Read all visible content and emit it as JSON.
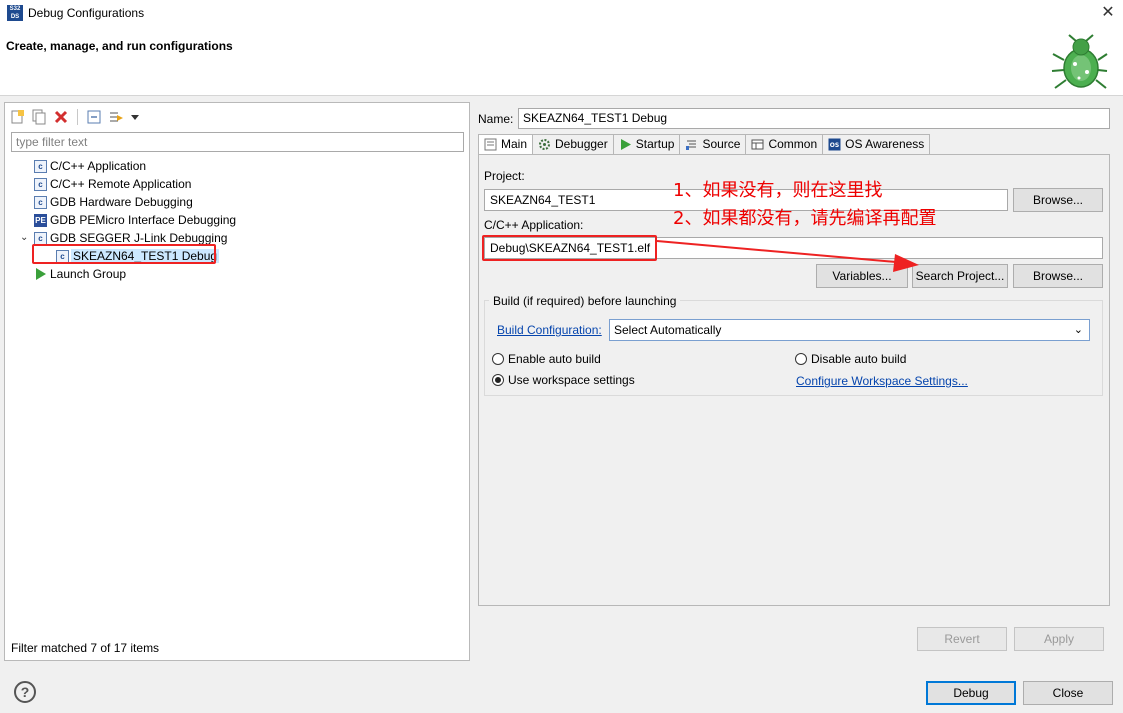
{
  "window": {
    "title": "Debug Configurations",
    "app_icon": "S32\nDS"
  },
  "header": {
    "heading": "Create, manage, and run configurations"
  },
  "left": {
    "filter_placeholder": "type filter text",
    "tree": [
      {
        "label": "C/C++ Application",
        "icon": "c-config-icon"
      },
      {
        "label": "C/C++ Remote Application",
        "icon": "c-config-icon"
      },
      {
        "label": "GDB Hardware Debugging",
        "icon": "c-config-icon"
      },
      {
        "label": "GDB PEMicro Interface Debugging",
        "icon": "pemicro-icon"
      },
      {
        "label": "GDB SEGGER J-Link Debugging",
        "icon": "c-config-icon",
        "expanded": true
      },
      {
        "label": "SKEAZN64_TEST1 Debug",
        "icon": "c-config-icon",
        "selected": true
      },
      {
        "label": "Launch Group",
        "icon": "launch-group-icon"
      }
    ],
    "status": "Filter matched 7 of 17 items"
  },
  "right": {
    "name_label": "Name:",
    "name_value": "SKEAZN64_TEST1 Debug",
    "tabs": [
      {
        "label": "Main",
        "active": true
      },
      {
        "label": "Debugger"
      },
      {
        "label": "Startup"
      },
      {
        "label": "Source"
      },
      {
        "label": "Common"
      },
      {
        "label": "OS Awareness"
      }
    ],
    "main": {
      "project_label": "Project:",
      "project_value": "SKEAZN64_TEST1",
      "browse1": "Browse...",
      "app_label": "C/C++ Application:",
      "app_value": "Debug\\SKEAZN64_TEST1.elf",
      "variables": "Variables...",
      "search_project": "Search Project...",
      "browse2": "Browse...",
      "build_group_title": "Build (if required) before launching",
      "build_config_link": "Build Configuration:",
      "build_config_value": "Select Automatically",
      "enable_auto_build": "Enable auto build",
      "disable_auto_build": "Disable auto build",
      "use_workspace": "Use workspace settings",
      "configure_workspace": "Configure Workspace Settings..."
    },
    "annotations": [
      "1、如果没有，则在这里找",
      "2、如果都没有，请先编译再配置"
    ],
    "revert": "Revert",
    "apply": "Apply"
  },
  "footer": {
    "debug": "Debug",
    "close": "Close",
    "help": "?"
  }
}
